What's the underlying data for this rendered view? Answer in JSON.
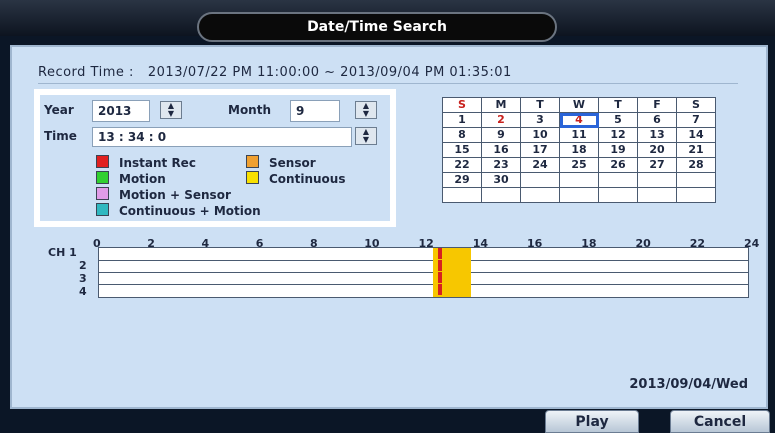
{
  "title": "Date/Time Search",
  "record": {
    "label": "Record Time :",
    "value": "2013/07/22 PM 11:00:00 ~ 2013/09/04 PM 01:35:01"
  },
  "year": {
    "label": "Year",
    "value": "2013"
  },
  "month": {
    "label": "Month",
    "value": "9"
  },
  "time": {
    "label": "Time",
    "value": "13 : 34 : 0"
  },
  "legend": [
    {
      "label": "Instant Rec",
      "color": "#e02020"
    },
    {
      "label": "Sensor",
      "color": "#f0a030"
    },
    {
      "label": "Motion",
      "color": "#30d030"
    },
    {
      "label": "Continuous",
      "color": "#f8e000"
    },
    {
      "label": "Motion + Sensor",
      "color": "#e09ce8"
    },
    {
      "label": "Continuous + Motion",
      "color": "#30b8c0"
    }
  ],
  "calendar": {
    "weekdays": [
      "S",
      "M",
      "T",
      "W",
      "T",
      "F",
      "S"
    ],
    "weeks": [
      [
        "1",
        "2",
        "3",
        "4",
        "5",
        "6",
        "7"
      ],
      [
        "8",
        "9",
        "10",
        "11",
        "12",
        "13",
        "14"
      ],
      [
        "15",
        "16",
        "17",
        "18",
        "19",
        "20",
        "21"
      ],
      [
        "22",
        "23",
        "24",
        "25",
        "26",
        "27",
        "28"
      ],
      [
        "29",
        "30",
        "",
        "",
        "",
        "",
        ""
      ],
      [
        "",
        "",
        "",
        "",
        "",
        "",
        ""
      ]
    ],
    "highlight_red": [
      "2",
      "4"
    ],
    "selected": "4"
  },
  "timeline": {
    "hours": [
      "0",
      "2",
      "4",
      "6",
      "8",
      "10",
      "12",
      "14",
      "16",
      "18",
      "20",
      "22",
      "24"
    ],
    "channels": [
      "CH 1",
      "2",
      "3",
      "4"
    ],
    "recording_start_hour": 12.3,
    "recording_end_hour": 13.7,
    "instant_marker_hour": 12.5
  },
  "status": {
    "date": "2013/09/04/Wed"
  },
  "buttons": {
    "play": "Play",
    "cancel": "Cancel"
  }
}
